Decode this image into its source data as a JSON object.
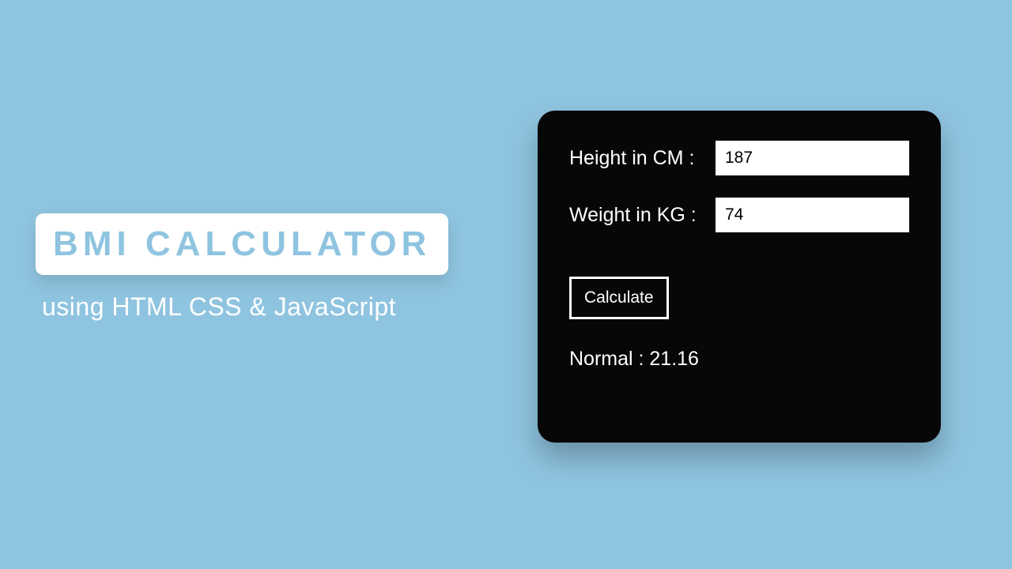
{
  "left": {
    "title": "BMI CALCULATOR",
    "subtitle": "using HTML CSS & JavaScript"
  },
  "calculator": {
    "height_label": "Height in CM :",
    "height_value": "187",
    "weight_label": "Weight in KG :",
    "weight_value": "74",
    "button_label": "Calculate",
    "result_text": "Normal : 21.16"
  }
}
